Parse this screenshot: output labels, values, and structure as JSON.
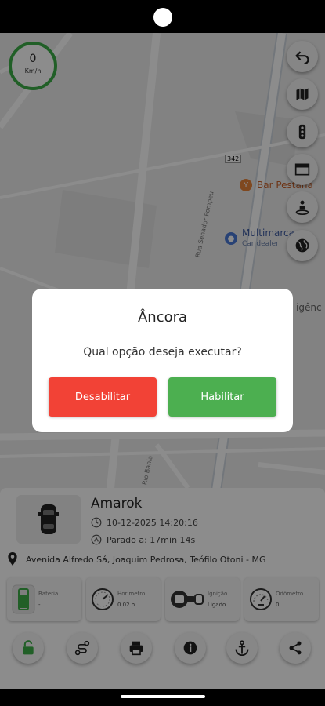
{
  "speedometer": {
    "value": "0",
    "unit": "Km/h"
  },
  "map": {
    "poi_bar": "Bar Pestana",
    "poi_multimarcas": "Multimarca",
    "poi_multimarcas_sub": "Car dealer",
    "street_1": "Rua Senador Pompeu",
    "street_2": "Rio Bahia",
    "route_badge": "342",
    "edge_label": "igênc"
  },
  "map_controls": [
    {
      "name": "back-button",
      "icon": "undo-arrow-icon"
    },
    {
      "name": "map-layers-button",
      "icon": "map-icon"
    },
    {
      "name": "traffic-button",
      "icon": "traffic-light-icon"
    },
    {
      "name": "map-view-button",
      "icon": "window-icon"
    },
    {
      "name": "street-view-button",
      "icon": "person-pin-icon"
    },
    {
      "name": "globe-button",
      "icon": "globe-icon"
    }
  ],
  "dialog": {
    "title": "Âncora",
    "message": "Qual opção deseja executar?",
    "disable_label": "Desabilitar",
    "enable_label": "Habilitar",
    "disable_color": "#f24236",
    "enable_color": "#4caf50"
  },
  "vehicle": {
    "name": "Amarok",
    "datetime": "10-12-2025 14:20:16",
    "stopped": "Parado a: 17min 14s",
    "address": "Avenida Alfredo Sá, Joaquim Pedrosa, Teófilo Otoni - MG"
  },
  "stats": [
    {
      "label": "Bateria",
      "value": "-",
      "icon": "battery-icon"
    },
    {
      "label": "Horimetro",
      "value": "0.02 h",
      "icon": "gauge-icon"
    },
    {
      "label": "Ignição",
      "value": "Ligado",
      "icon": "ignition-key-icon"
    },
    {
      "label": "Odômetro",
      "value": "0",
      "icon": "odometer-icon"
    }
  ],
  "actions": [
    {
      "name": "unlock-button",
      "icon": "unlock-icon"
    },
    {
      "name": "route-button",
      "icon": "route-icon"
    },
    {
      "name": "print-button",
      "icon": "printer-icon"
    },
    {
      "name": "info-button",
      "icon": "info-icon"
    },
    {
      "name": "anchor-button",
      "icon": "anchor-icon"
    },
    {
      "name": "share-button",
      "icon": "share-icon"
    }
  ],
  "colors": {
    "accent_green": "#3cae47",
    "danger_red": "#f24236"
  }
}
